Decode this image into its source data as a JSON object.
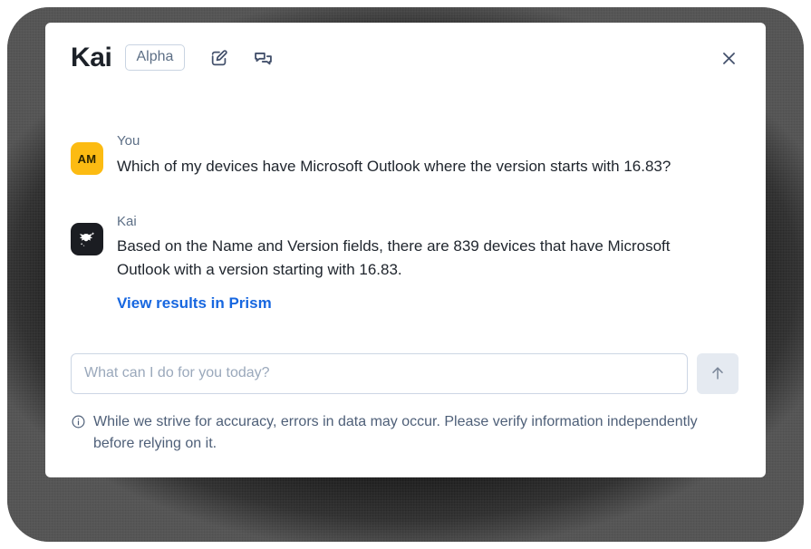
{
  "window": {
    "brand_title": "Kai",
    "badge_label": "Alpha",
    "compose_icon": "compose-icon",
    "conversations_icon": "conversations-icon",
    "close_icon": "close-icon"
  },
  "conversation": {
    "messages": [
      {
        "author": "You",
        "avatar_initials": "AM",
        "avatar_color": "#FCBB12",
        "text": "Which of my devices have Microsoft Outlook where the version starts with 16.83?"
      },
      {
        "author": "Kai",
        "avatar_initials": "",
        "avatar_color": "#1B1D22",
        "text": "Based on the Name and Version fields, there are 839 devices that have Microsoft Outlook with a version starting with 16.83.",
        "link_label": "View results in Prism"
      }
    ]
  },
  "composer": {
    "placeholder": "What can I do for you today?",
    "value": "",
    "send_icon": "arrow-up-icon"
  },
  "disclaimer": {
    "info_icon": "info-circle-icon",
    "text": "While we strive for accuracy, errors in data may occur. Please verify information independently before relying on it."
  },
  "colors": {
    "link": "#1767E0",
    "accent_avatar": "#FCBB12",
    "muted_text": "#5D6F86",
    "body_text": "#20262E"
  }
}
